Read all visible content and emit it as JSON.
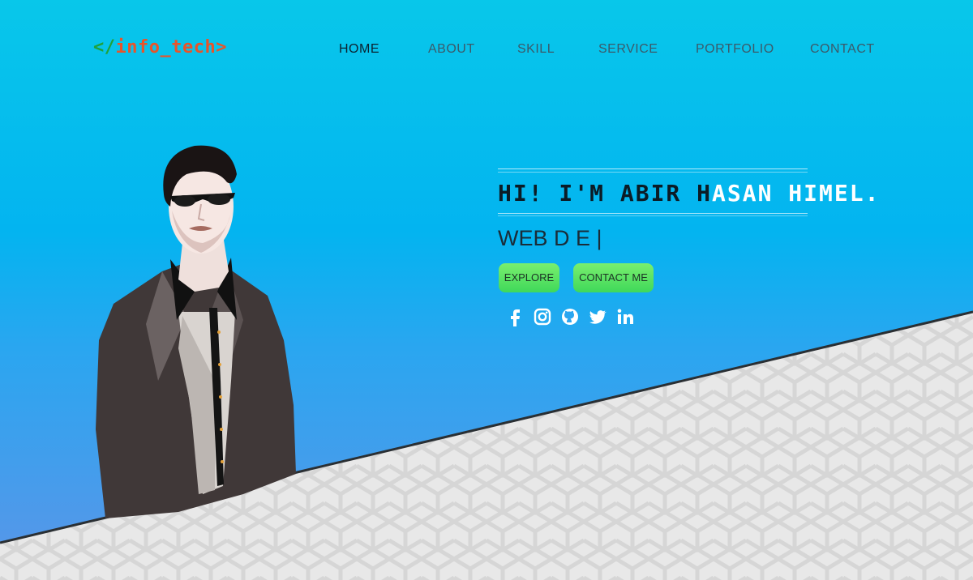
{
  "logo": {
    "open": "</",
    "name": "info_tech",
    "close": ">"
  },
  "nav": {
    "items": [
      {
        "label": "HOME"
      },
      {
        "label": "ABOUT"
      },
      {
        "label": "SKILL"
      },
      {
        "label": "SERVICE"
      },
      {
        "label": "PORTFOLIO"
      },
      {
        "label": "CONTACT"
      }
    ],
    "active": "HOME"
  },
  "intro": {
    "headline_dark": "HI! I'M ABIR H",
    "headline_light": "ASAN HIMEL.",
    "typed": "WEB D E |"
  },
  "buttons": {
    "explore": "EXPLORE",
    "contact": "CONTACT ME"
  },
  "socials": [
    "facebook-icon",
    "instagram-icon",
    "github-icon",
    "twitter-icon",
    "linkedin-icon"
  ],
  "colors": {
    "sky_top": "#08c7ea",
    "sky_bottom": "#5b95e8",
    "button_green": "#4fe05f",
    "logo_green": "#1fa23a",
    "logo_orange": "#e8542a",
    "ground": "#e6e6e6"
  }
}
